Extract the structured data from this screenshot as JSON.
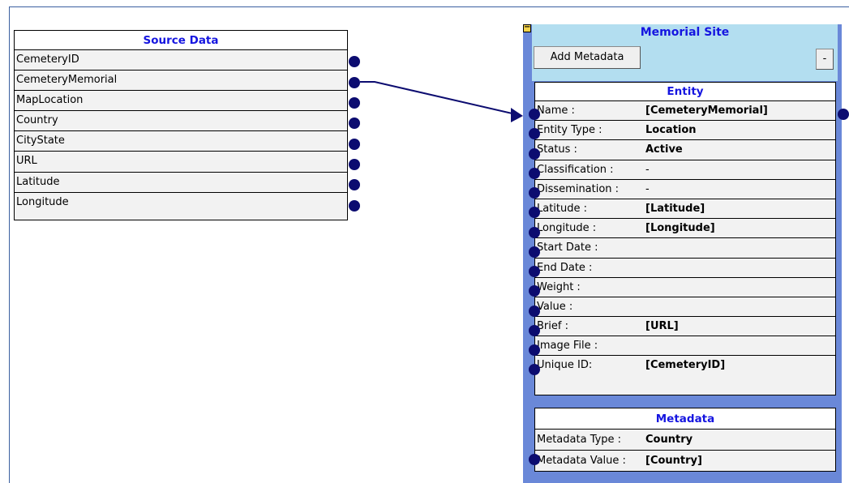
{
  "source": {
    "title": "Source Data",
    "fields": [
      "CemeteryID",
      "CemeteryMemorial",
      "MapLocation",
      "Country",
      "CityState",
      "URL",
      "Latitude",
      "Longitude"
    ]
  },
  "memorial": {
    "title": "Memorial Site",
    "toggle": "−",
    "add_metadata_label": "Add Metadata",
    "minus_label": "-",
    "entity": {
      "title": "Entity",
      "rows": [
        {
          "label": "Name :",
          "value": "[CemeteryMemorial]"
        },
        {
          "label": "Entity Type :",
          "value": "Location"
        },
        {
          "label": "Status :",
          "value": "Active"
        },
        {
          "label": "Classification :",
          "value": "-"
        },
        {
          "label": "Dissemination :",
          "value": "-"
        },
        {
          "label": "Latitude :",
          "value": "[Latitude]"
        },
        {
          "label": "Longitude :",
          "value": "[Longitude]"
        },
        {
          "label": "Start Date :",
          "value": ""
        },
        {
          "label": "End Date :",
          "value": ""
        },
        {
          "label": "Weight :",
          "value": ""
        },
        {
          "label": "Value :",
          "value": ""
        },
        {
          "label": "Brief :",
          "value": "[URL]"
        },
        {
          "label": "Image File :",
          "value": ""
        },
        {
          "label": "Unique ID:",
          "value": "[CemeteryID]"
        }
      ]
    },
    "metadata": {
      "title": "Metadata",
      "rows": [
        {
          "label": "Metadata Type :",
          "value": "Country"
        },
        {
          "label": "Metadata Value :",
          "value": "[Country]"
        }
      ]
    }
  },
  "connection": {
    "from": "CemeteryMemorial",
    "to": "Name :"
  },
  "colors": {
    "title_blue": "#1515e0",
    "panel_blue": "#6a88d8",
    "inner_blue": "#b3def0",
    "dot": "#0c0c70"
  }
}
